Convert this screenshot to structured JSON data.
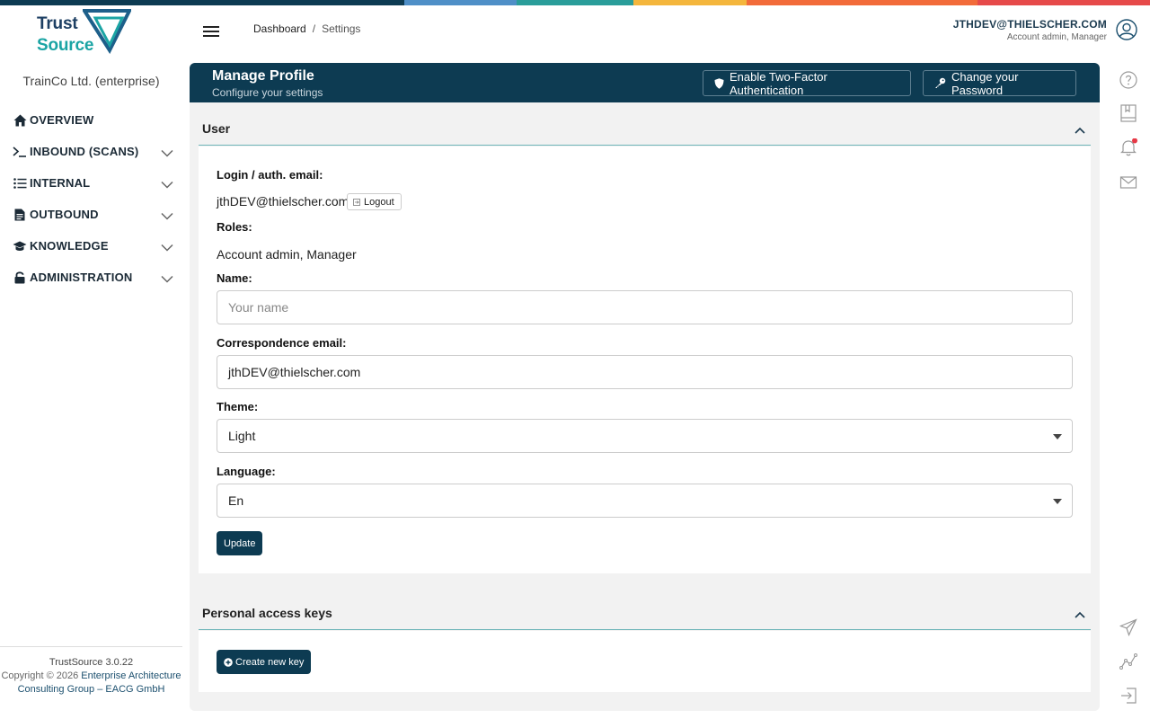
{
  "brand": {
    "logo_line1": "Trust",
    "logo_line2": "Source",
    "strip_colors": [
      "#0d3b52",
      "#1d5f8a",
      "#4f8fc7",
      "#2a9d9a",
      "#f4b63d",
      "#f26b3a",
      "#e63946"
    ]
  },
  "sidebar": {
    "organization": "TrainCo Ltd. (enterprise)",
    "items": [
      {
        "label": "OVERVIEW",
        "icon": "home-icon",
        "expandable": false
      },
      {
        "label": "INBOUND (SCANS)",
        "icon": "terminal-icon",
        "expandable": true
      },
      {
        "label": "INTERNAL",
        "icon": "list-icon",
        "expandable": true
      },
      {
        "label": "OUTBOUND",
        "icon": "document-icon",
        "expandable": true
      },
      {
        "label": "KNOWLEDGE",
        "icon": "graduation-cap-icon",
        "expandable": true
      },
      {
        "label": "ADMINISTRATION",
        "icon": "lock-icon",
        "expandable": true
      }
    ],
    "footer": {
      "version": "TrustSource 3.0.22",
      "copyright": "Copyright © 2026",
      "company_link": "Enterprise Architecture Consulting Group – EACG GmbH"
    }
  },
  "header": {
    "breadcrumb": [
      "Dashboard",
      "Settings"
    ],
    "breadcrumb_separator": "/",
    "user_email": "JTHDEV@THIELSCHER.COM",
    "user_roles": "Account admin, Manager"
  },
  "right_rail": [
    "help-icon",
    "book-icon",
    "bell-icon",
    "mail-icon",
    "send-icon",
    "chart-line-icon",
    "sign-out-icon"
  ],
  "panel": {
    "title": "Manage Profile",
    "subtitle": "Configure your settings",
    "two_factor_button": "Enable Two-Factor Authentication",
    "change_password_button": "Change your Password"
  },
  "user_section": {
    "title": "User",
    "login_label": "Login / auth. email:",
    "login_value": "jthDEV@thielscher.com",
    "logout_button": "Logout",
    "roles_label": "Roles:",
    "roles_value": "Account admin, Manager",
    "name_label": "Name:",
    "name_value": "",
    "name_placeholder": "Your name",
    "corr_email_label": "Correspondence email:",
    "corr_email_value": "jthDEV@thielscher.com",
    "theme_label": "Theme:",
    "theme_value": "Light",
    "language_label": "Language:",
    "language_value": "En",
    "update_button": "Update"
  },
  "keys_section": {
    "title": "Personal access keys",
    "create_button": "Create new key"
  },
  "colors": {
    "brand_dark": "#0d3b52",
    "accent_teal": "#6fb6b9",
    "notification": "#e63946"
  }
}
